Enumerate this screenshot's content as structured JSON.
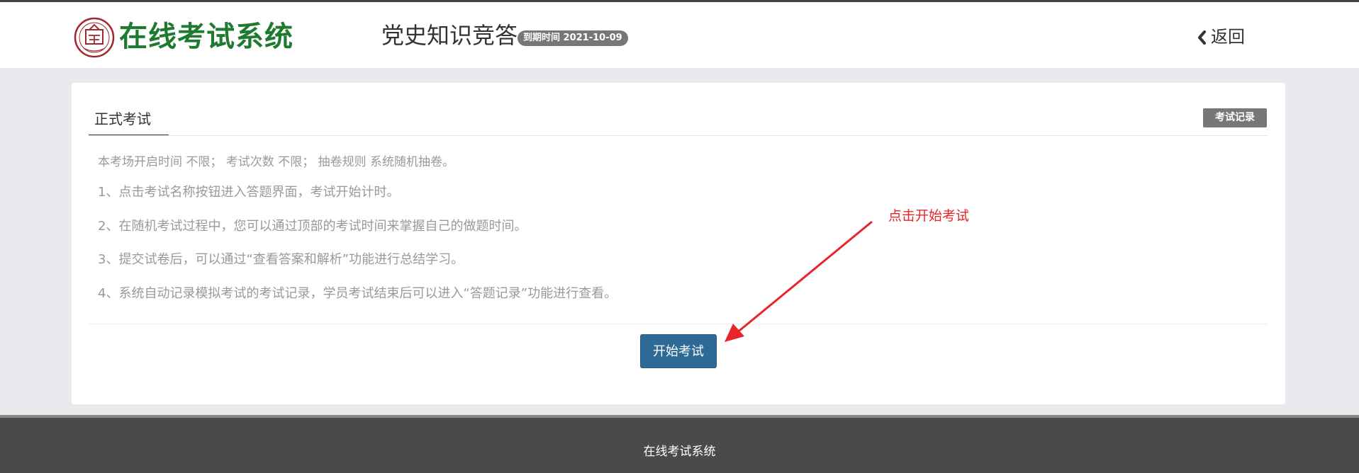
{
  "header": {
    "logo_text": "在线考试系统",
    "exam_title": "党史知识竞答",
    "expire_badge": "到期时间 2021-10-09",
    "back_label": "返回"
  },
  "tabs": [
    {
      "label": "正式考试",
      "active": true
    }
  ],
  "record_button": "考试记录",
  "intro": "本考场开启时间 不限； 考试次数 不限； 抽卷规则 系统随机抽卷。",
  "rules": [
    {
      "num": "1、",
      "text": "点击考试名称按钮进入答题界面，考试开始计时。"
    },
    {
      "num": "2、",
      "text": "在随机考试过程中，您可以通过顶部的考试时间来掌握自己的做题时间。"
    },
    {
      "num": "3、",
      "text": "提交试卷后，可以通过“查看答案和解析”功能进行总结学习。"
    },
    {
      "num": "4、",
      "text": "系统自动记录模拟考试的考试记录，学员考试结束后可以进入“答题记录”功能进行查看。"
    }
  ],
  "start_button": "开始考试",
  "annotation": "点击开始考试",
  "footer": "在线考试系统",
  "colors": {
    "logo_green": "#1d7a2f",
    "seal_red": "#a0282d",
    "primary_button": "#2d6a96",
    "annotation_red": "#e8242a",
    "badge_gray": "#777777",
    "footer_bg": "#4a4a4a"
  }
}
